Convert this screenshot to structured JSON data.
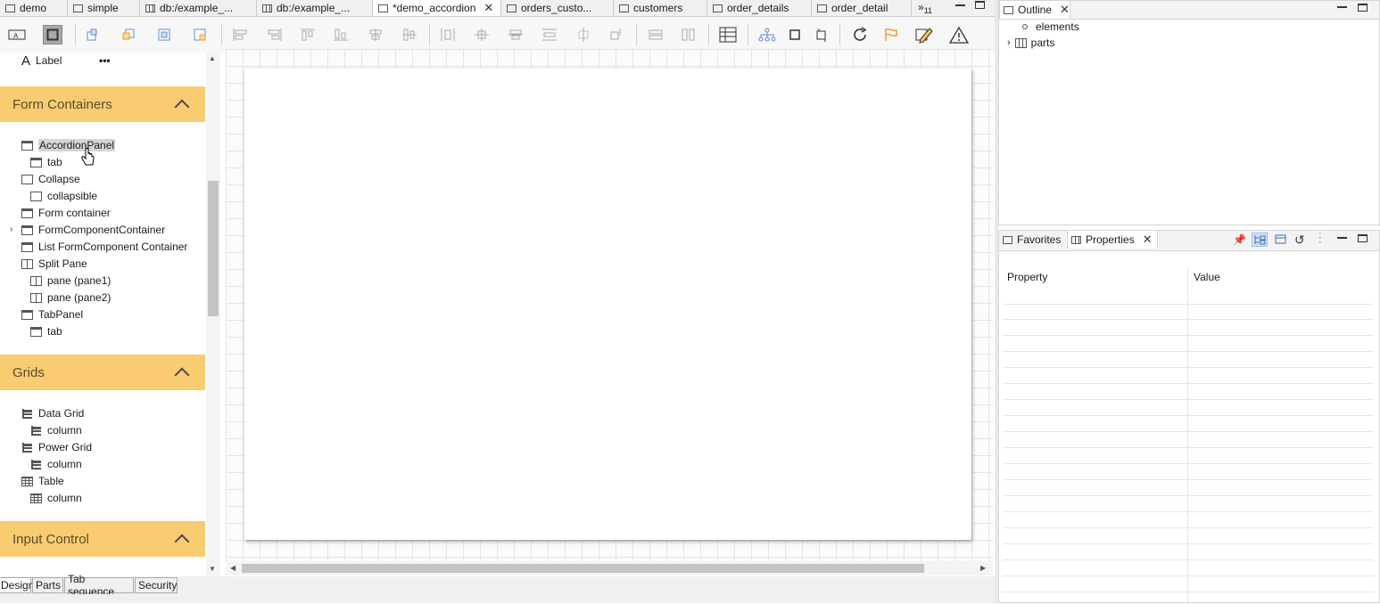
{
  "editor_tabs": [
    {
      "label": "demo",
      "icon": "form-icon"
    },
    {
      "label": "simple",
      "icon": "form-icon"
    },
    {
      "label": "db:/example_...",
      "icon": "table-icon"
    },
    {
      "label": "db:/example_...",
      "icon": "table-icon"
    },
    {
      "label": "*demo_accordion",
      "icon": "form-icon",
      "active": true
    },
    {
      "label": "orders_custo...",
      "icon": "form-icon"
    },
    {
      "label": "customers",
      "icon": "form-icon"
    },
    {
      "label": "order_details",
      "icon": "form-icon"
    },
    {
      "label": "order_detail",
      "icon": "form-icon"
    }
  ],
  "overflow_tabs": {
    "chevron": "»",
    "count": "11"
  },
  "palette": {
    "top_items": [
      {
        "label": "Label",
        "icon": "label-icon"
      }
    ],
    "more_glyph": "•••",
    "categories": [
      {
        "name": "Form Containers",
        "items": [
          {
            "label": "AccordionPanel",
            "icon": "folder-icon",
            "level": 0,
            "highlighted": true
          },
          {
            "label": "tab",
            "icon": "folder-icon",
            "level": 1
          },
          {
            "label": "Collapse",
            "icon": "container-icon",
            "level": 0
          },
          {
            "label": "collapsible",
            "icon": "container-icon",
            "level": 1
          },
          {
            "label": "Form container",
            "icon": "folder-icon",
            "level": 0
          },
          {
            "label": "FormComponentContainer",
            "icon": "form-component-icon",
            "level": 0,
            "expandable": true
          },
          {
            "label": "List FormComponent Container",
            "icon": "form-component-icon",
            "level": 0
          },
          {
            "label": "Split Pane",
            "icon": "split-pane-icon",
            "level": 0
          },
          {
            "label": "pane (pane1)",
            "icon": "split-pane-icon",
            "level": 1
          },
          {
            "label": "pane (pane2)",
            "icon": "split-pane-icon",
            "level": 1
          },
          {
            "label": "TabPanel",
            "icon": "folder-icon",
            "level": 0
          },
          {
            "label": "tab",
            "icon": "folder-icon",
            "level": 1
          }
        ]
      },
      {
        "name": "Grids",
        "items": [
          {
            "label": "Data Grid",
            "icon": "tree-grid-icon",
            "level": 0
          },
          {
            "label": "column",
            "icon": "tree-grid-icon",
            "level": 1
          },
          {
            "label": "Power Grid",
            "icon": "tree-grid-icon",
            "level": 0
          },
          {
            "label": "column",
            "icon": "tree-grid-icon",
            "level": 1
          },
          {
            "label": "Table",
            "icon": "table-icon",
            "level": 0
          },
          {
            "label": "column",
            "icon": "table-icon",
            "level": 1
          }
        ]
      },
      {
        "name": "Input Control",
        "items": []
      }
    ]
  },
  "bottom_tabs": [
    {
      "label": "Design",
      "active": true
    },
    {
      "label": "Parts"
    },
    {
      "label": "Tab sequence"
    },
    {
      "label": "Security"
    }
  ],
  "outline": {
    "tab_label": "Outline",
    "items": [
      {
        "label": "elements",
        "icon": "bullet-icon"
      },
      {
        "label": "parts",
        "icon": "parts-icon",
        "expandable": true
      }
    ]
  },
  "properties": {
    "tabs": [
      {
        "label": "Favorites",
        "icon": "favorites-icon"
      },
      {
        "label": "Properties",
        "icon": "properties-icon",
        "active": true
      }
    ],
    "columns": [
      "Property",
      "Value"
    ]
  },
  "colors": {
    "category_header": "#f9cc71",
    "category_text": "#5b4a2a",
    "selection": "#d5d5d5",
    "canvas_grid": "#e4e4e4"
  }
}
